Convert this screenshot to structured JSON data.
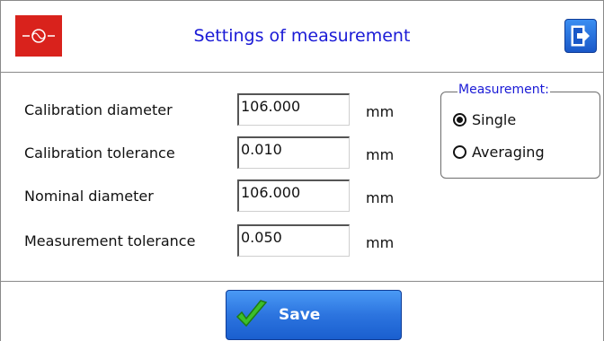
{
  "header": {
    "title": "Settings of measurement",
    "logo_icon": "company-logo",
    "exit_icon": "exit-icon"
  },
  "fields": [
    {
      "label": "Calibration diameter",
      "value": "106.000",
      "unit": "mm"
    },
    {
      "label": "Calibration tolerance",
      "value": "0.010",
      "unit": "mm"
    },
    {
      "label": "Nominal diameter",
      "value": "106.000",
      "unit": "mm"
    },
    {
      "label": "Measurement tolerance",
      "value": "0.050",
      "unit": "mm"
    }
  ],
  "measurement_group": {
    "title": "Measurement:",
    "options": [
      {
        "label": "Single",
        "selected": true
      },
      {
        "label": "Averaging",
        "selected": false
      }
    ]
  },
  "footer": {
    "save_label": "Save",
    "save_icon": "checkmark-icon"
  },
  "colors": {
    "title": "#1a1ad6",
    "logo_bg": "#d9221c",
    "button_blue": "#2c74df"
  }
}
